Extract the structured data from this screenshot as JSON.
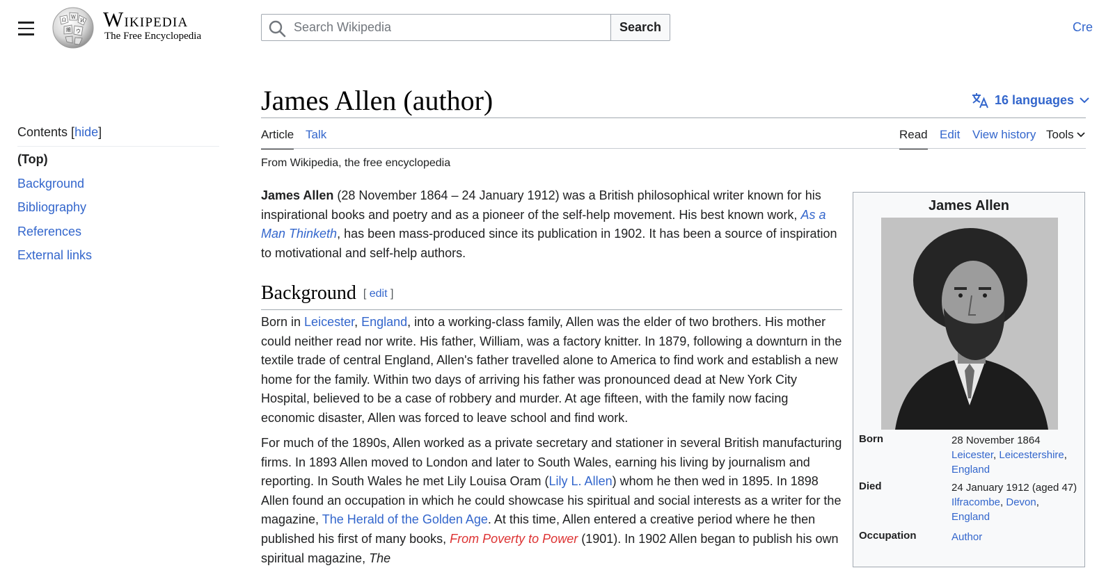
{
  "header": {
    "logo_title": "Wikipedia",
    "logo_tagline": "The Free Encyclopedia",
    "search_placeholder": "Search Wikipedia",
    "search_button": "Search",
    "create_account": "Cre"
  },
  "toc": {
    "heading": "Contents",
    "hide_label": "hide",
    "items": [
      {
        "label": "(Top)"
      },
      {
        "label": "Background"
      },
      {
        "label": "Bibliography"
      },
      {
        "label": "References"
      },
      {
        "label": "External links"
      }
    ]
  },
  "article": {
    "title": "James Allen (author)",
    "languages": "16 languages",
    "tabs": {
      "article": "Article",
      "talk": "Talk",
      "read": "Read",
      "edit": "Edit",
      "view_history": "View history",
      "tools": "Tools"
    },
    "tagline": "From Wikipedia, the free encyclopedia",
    "intro": {
      "name": "James Allen",
      "t1": " (28 November 1864 – 24 January 1912) was a British philosophical writer known for his inspirational books and poetry and as a pioneer of the self-help movement. His best known work, ",
      "link_book": "As a Man Thinketh",
      "t2": ", has been mass-produced since its publication in 1902. It has been a source of inspiration to motivational and self-help authors."
    },
    "background_heading": "Background",
    "edit_label": "edit",
    "para1": {
      "t1": "Born in ",
      "link_leicester": "Leicester",
      "t2": ", ",
      "link_england": "England",
      "t3": ", into a working-class family, Allen was the elder of two brothers. His mother could neither read nor write. His father, William, was a factory knitter. In 1879, following a downturn in the textile trade of central England, Allen's father travelled alone to America to find work and establish a new home for the family. Within two days of arriving his father was pronounced dead at New York City Hospital, believed to be a case of robbery and murder. At age fifteen, with the family now facing economic disaster, Allen was forced to leave school and find work."
    },
    "para2": {
      "t1": "For much of the 1890s, Allen worked as a private secretary and stationer in several British manufacturing firms. In 1893 Allen moved to London and later to South Wales, earning his living by journalism and reporting. In South Wales he met Lily Louisa Oram (",
      "link_lily": "Lily L. Allen",
      "t2": ") whom he then wed in 1895. In 1898 Allen found an occupation in which he could showcase his spiritual and social interests as a writer for the magazine, ",
      "link_herald": "The Herald of the Golden Age",
      "t3": ". At this time, Allen entered a creative period where he then published his first of many books, ",
      "link_poverty": "From Poverty to Power",
      "t4": " (1901). In 1902 Allen began to publish his own spiritual magazine, ",
      "t5": "The"
    }
  },
  "infobox": {
    "title": "James Allen",
    "born_label": "Born",
    "born_date": "28 November 1864",
    "born_place1": "Leicester",
    "born_place2": "Leicestershire",
    "born_place3": "England",
    "died_label": "Died",
    "died_date": "24 January 1912 (aged 47)",
    "died_place1": "Ilfracombe",
    "died_place2": "Devon",
    "died_place3": "England",
    "occupation_label": "Occupation",
    "occupation": "Author"
  },
  "colors": {
    "link": "#3366cc",
    "redlink": "#dd3333",
    "text": "#202122"
  },
  "icons": [
    "menu-icon",
    "wikipedia-globe-icon",
    "search-icon",
    "translate-icon",
    "chevron-down-icon"
  ]
}
